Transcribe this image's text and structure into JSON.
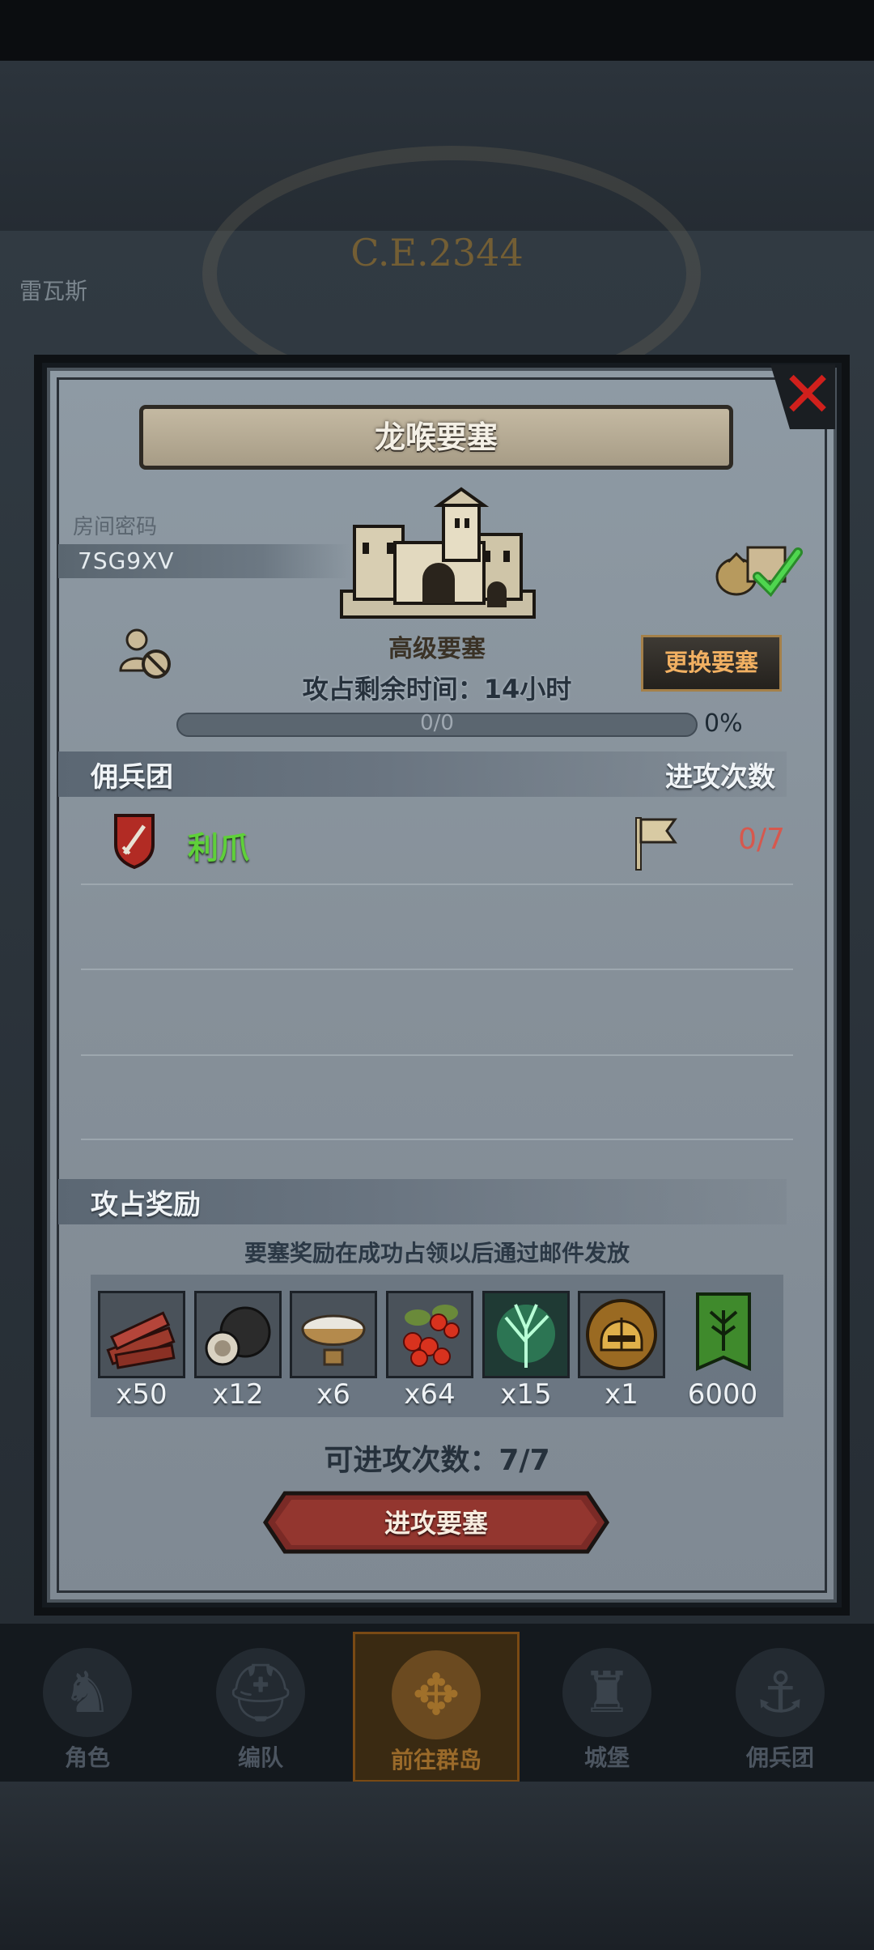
{
  "background": {
    "year": "C.E.2344",
    "place": "雷瓦斯"
  },
  "modal": {
    "title": "龙喉要塞",
    "room_label": "房间密码",
    "room_code": "7SG9XV",
    "fort_level": "高级要塞",
    "change_button": "更换要塞",
    "time_left": "攻占剩余时间：14小时",
    "progress_text": "0/0",
    "progress_pct": "0%",
    "progress_value": 0,
    "mercenary_header": "佣兵团",
    "attacks_header": "进攻次数",
    "mercenaries": [
      {
        "name": "利爪",
        "attacks": "0/7"
      }
    ],
    "reward_header": "攻占奖励",
    "reward_note": "要塞奖励在成功占领以后通过邮件发放",
    "rewards": [
      {
        "icon": "wood-planks-icon",
        "qty": "x50"
      },
      {
        "icon": "truffle-icon",
        "qty": "x12"
      },
      {
        "icon": "bowl-icon",
        "qty": "x6"
      },
      {
        "icon": "berries-icon",
        "qty": "x64"
      },
      {
        "icon": "green-crystal-tree-icon",
        "qty": "x15"
      },
      {
        "icon": "golden-helmet-icon",
        "qty": "x1"
      },
      {
        "icon": "guild-banner-icon",
        "qty": "6000"
      }
    ],
    "attacks_available": "可进攻次数：7/7",
    "attack_button": "进攻要塞"
  },
  "nav": {
    "items": [
      {
        "label": "角色",
        "icon": "knight-icon"
      },
      {
        "label": "编队",
        "icon": "helmet-icon"
      },
      {
        "label": "前往群岛",
        "icon": "compass-icon",
        "active": true
      },
      {
        "label": "城堡",
        "icon": "castle-icon"
      },
      {
        "label": "佣兵团",
        "icon": "ship-icon"
      }
    ]
  },
  "colors": {
    "merc_name": "#5fd03a",
    "attack_count": "#d6584e",
    "change_button_text": "#f1b062",
    "close": "#d0201c"
  }
}
